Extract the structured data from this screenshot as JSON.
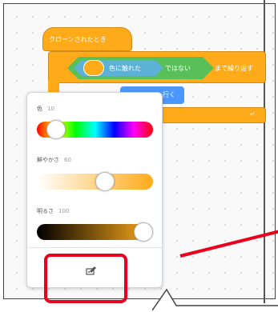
{
  "script": {
    "hat_label": "クローンされたとき",
    "touch_color_label": "色に触れた",
    "not_label": "ではない",
    "until_label": "まで繰り返す",
    "inner_label": "行く",
    "touch_swatch_color": "#ffab19",
    "loop_icon": "loop-arrow-icon"
  },
  "color_picker": {
    "hue_label": "色",
    "hue_value": "10",
    "saturation_label": "鮮やかさ",
    "saturation_value": "60",
    "brightness_label": "明るさ",
    "brightness_value": "100",
    "picker_icon": "eyedropper-icon",
    "knob_levels": {
      "hue": 0.1,
      "saturation": 0.6,
      "brightness": 1.0
    }
  },
  "colors": {
    "control_orange": "#ffab19",
    "operator_green": "#59c059",
    "sensing_blue": "#5cb1d6",
    "motion_blue": "#4c97ff",
    "annotation_red": "#e8001c"
  }
}
